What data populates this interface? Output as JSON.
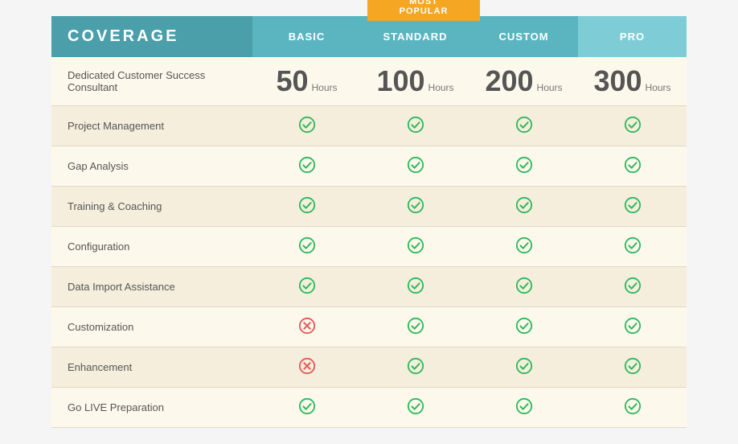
{
  "badge": {
    "label": "MOST POPULAR"
  },
  "header": {
    "coverage": "COVERAGE",
    "basic": "BASIC",
    "standard": "STANDARD",
    "custom": "CUSTOM",
    "pro": "PRO"
  },
  "consultant_row": {
    "label": "Dedicated Customer Success Consultant",
    "basic_num": "50",
    "basic_unit": "Hours",
    "standard_num": "100",
    "standard_unit": "Hours",
    "custom_num": "200",
    "custom_unit": "Hours",
    "pro_num": "300",
    "pro_unit": "Hours"
  },
  "rows": [
    {
      "label": "Project Management",
      "basic": "check",
      "standard": "check",
      "custom": "check",
      "pro": "check"
    },
    {
      "label": "Gap Analysis",
      "basic": "check",
      "standard": "check",
      "custom": "check",
      "pro": "check"
    },
    {
      "label": "Training & Coaching",
      "basic": "check",
      "standard": "check",
      "custom": "check",
      "pro": "check"
    },
    {
      "label": "Configuration",
      "basic": "check",
      "standard": "check",
      "custom": "check",
      "pro": "check"
    },
    {
      "label": "Data Import Assistance",
      "basic": "check",
      "standard": "check",
      "custom": "check",
      "pro": "check"
    },
    {
      "label": "Customization",
      "basic": "cross",
      "standard": "check",
      "custom": "check",
      "pro": "check"
    },
    {
      "label": "Enhancement",
      "basic": "cross",
      "standard": "check",
      "custom": "check",
      "pro": "check"
    },
    {
      "label": "Go LIVE Preparation",
      "basic": "check",
      "standard": "check",
      "custom": "check",
      "pro": "check"
    }
  ],
  "colors": {
    "header_bg": "#4a9faa",
    "col_bg": "#5ab5c0",
    "pro_bg": "#7ecdd6",
    "badge_bg": "#f5a623",
    "row_light": "#fdf8ec",
    "row_dark": "#f5eedc",
    "check_color": "#2db85a",
    "cross_color": "#e05a5a"
  }
}
